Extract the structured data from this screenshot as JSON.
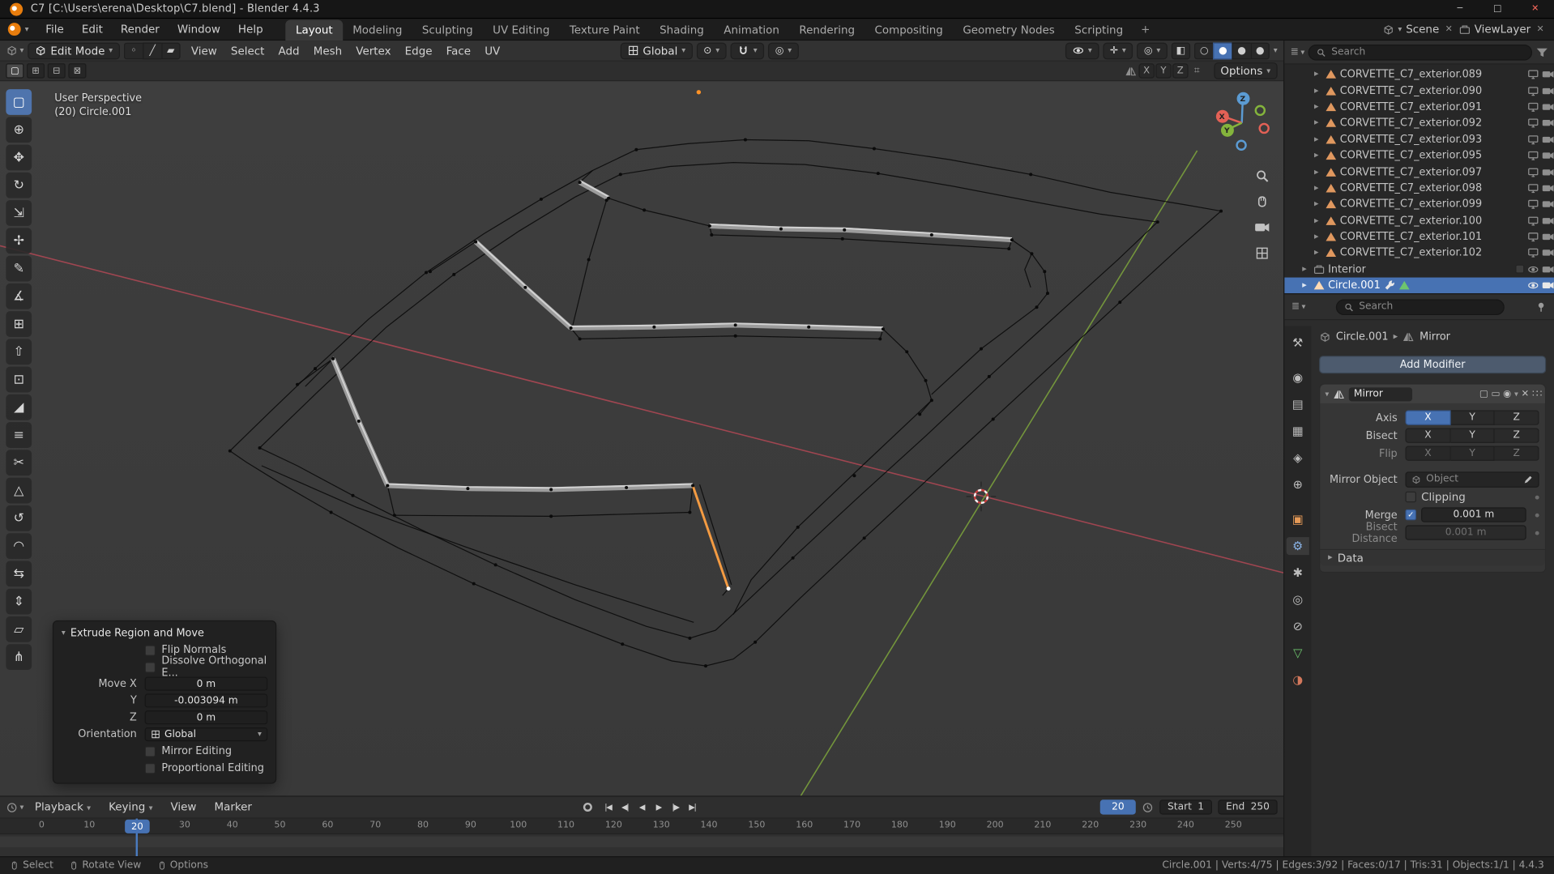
{
  "window": {
    "title": "C7 [C:\\Users\\erena\\Desktop\\C7.blend] - Blender 4.4.3",
    "minimize": "─",
    "maximize": "□",
    "close": "✕"
  },
  "topbar": {
    "menus": [
      "File",
      "Edit",
      "Render",
      "Window",
      "Help"
    ],
    "workspaces": [
      "Layout",
      "Modeling",
      "Sculpting",
      "UV Editing",
      "Texture Paint",
      "Shading",
      "Animation",
      "Rendering",
      "Compositing",
      "Geometry Nodes",
      "Scripting"
    ],
    "add_workspace": "+",
    "scene_label": "Scene",
    "view_layer_label": "ViewLayer"
  },
  "viewport": {
    "mode": "Edit Mode",
    "menus": [
      "View",
      "Select",
      "Add",
      "Mesh",
      "Vertex",
      "Edge",
      "Face",
      "UV"
    ],
    "orientation": "Global",
    "options_label": "Options",
    "overlay_line1": "User Perspective",
    "overlay_line2": "(20) Circle.001",
    "axes": [
      "X",
      "Y",
      "Z"
    ],
    "select_modes": [
      "◦",
      "╱",
      "▰"
    ],
    "tools": [
      {
        "name": "select-box-tool",
        "glyph": "▢"
      },
      {
        "name": "cursor-tool",
        "glyph": "⊕"
      },
      {
        "name": "move-tool",
        "glyph": "✥"
      },
      {
        "name": "rotate-tool",
        "glyph": "↻"
      },
      {
        "name": "scale-tool",
        "glyph": "⇲"
      },
      {
        "name": "transform-tool",
        "glyph": "✢"
      },
      {
        "name": "annotate-tool",
        "glyph": "✎"
      },
      {
        "name": "measure-tool",
        "glyph": "∡"
      },
      {
        "name": "add-cube-tool",
        "glyph": "⊞"
      },
      {
        "name": "extrude-region-tool",
        "glyph": "⇧"
      },
      {
        "name": "inset-faces-tool",
        "glyph": "⊡"
      },
      {
        "name": "bevel-tool",
        "glyph": "◢"
      },
      {
        "name": "loop-cut-tool",
        "glyph": "≡"
      },
      {
        "name": "knife-tool",
        "glyph": "✂"
      },
      {
        "name": "poly-build-tool",
        "glyph": "△"
      },
      {
        "name": "spin-tool",
        "glyph": "↺"
      },
      {
        "name": "smooth-tool",
        "glyph": "◠"
      },
      {
        "name": "edge-slide-tool",
        "glyph": "⇆"
      },
      {
        "name": "shrink-fatten-tool",
        "glyph": "⇕"
      },
      {
        "name": "shear-tool",
        "glyph": "▱"
      },
      {
        "name": "rip-region-tool",
        "glyph": "⋔"
      }
    ]
  },
  "operator_panel": {
    "title": "Extrude Region and Move",
    "flip_normals": "Flip Normals",
    "dissolve": "Dissolve Orthogonal E...",
    "move_x_label": "Move X",
    "move_x": "0 m",
    "y_label": "Y",
    "move_y": "-0.003094 m",
    "z_label": "Z",
    "move_z": "0 m",
    "orientation_label": "Orientation",
    "orientation_value": "Global",
    "mirror_editing": "Mirror Editing",
    "proportional_editing": "Proportional Editing"
  },
  "timeline": {
    "playback_label": "Playback",
    "keying_label": "Keying",
    "view_label": "View",
    "marker_label": "Marker",
    "transport": [
      {
        "name": "jump-to-start-button",
        "glyph": "|◀"
      },
      {
        "name": "jump-to-previous-keyframe-button",
        "glyph": "◀|"
      },
      {
        "name": "play-reverse-button",
        "glyph": "◀"
      },
      {
        "name": "play-button",
        "glyph": "▶"
      },
      {
        "name": "jump-to-next-keyframe-button",
        "glyph": "|▶"
      },
      {
        "name": "jump-to-end-button",
        "glyph": "▶|"
      }
    ],
    "current_frame": "20",
    "playhead_frame": "20",
    "start_label": "Start",
    "start_value": "1",
    "end_label": "End",
    "end_value": "250",
    "ticks": [
      "0",
      "10",
      "20",
      "30",
      "40",
      "50",
      "60",
      "70",
      "80",
      "90",
      "100",
      "110",
      "120",
      "130",
      "140",
      "150",
      "160",
      "170",
      "180",
      "190",
      "200",
      "210",
      "220",
      "230",
      "240",
      "250"
    ]
  },
  "outliner": {
    "search_placeholder": "Search",
    "collection_items": [
      "CORVETTE_C7_exterior.089",
      "CORVETTE_C7_exterior.090",
      "CORVETTE_C7_exterior.091",
      "CORVETTE_C7_exterior.092",
      "CORVETTE_C7_exterior.093",
      "CORVETTE_C7_exterior.095",
      "CORVETTE_C7_exterior.097",
      "CORVETTE_C7_exterior.098",
      "CORVETTE_C7_exterior.099",
      "CORVETTE_C7_exterior.100",
      "CORVETTE_C7_exterior.101",
      "CORVETTE_C7_exterior.102"
    ],
    "interior_label": "Interior",
    "selected_item": "Circle.001"
  },
  "properties": {
    "search_placeholder": "Search",
    "tabs": [
      {
        "name": "tab-tool",
        "glyph": "⚒"
      },
      {
        "name": "tab-render",
        "glyph": "◉"
      },
      {
        "name": "tab-output",
        "glyph": "▤"
      },
      {
        "name": "tab-view-layer",
        "glyph": "▦"
      },
      {
        "name": "tab-scene",
        "glyph": "◈"
      },
      {
        "name": "tab-world",
        "glyph": "⊕"
      },
      {
        "name": "tab-object",
        "glyph": "▣"
      },
      {
        "name": "tab-modifiers",
        "glyph": "⚙"
      },
      {
        "name": "tab-particles",
        "glyph": "✱"
      },
      {
        "name": "tab-physics",
        "glyph": "◎"
      },
      {
        "name": "tab-constraints",
        "glyph": "⊘"
      },
      {
        "name": "tab-object-data",
        "glyph": "▽"
      },
      {
        "name": "tab-material",
        "glyph": "◑"
      }
    ],
    "breadcrumb": {
      "object": "Circle.001",
      "separator": "▸",
      "modifier": "Mirror"
    },
    "add_modifier_label": "Add Modifier",
    "modifier": {
      "name": "Mirror",
      "axis_label": "Axis",
      "bisect_label": "Bisect",
      "flip_label": "Flip",
      "axes": [
        "X",
        "Y",
        "Z"
      ],
      "mirror_object_label": "Mirror Object",
      "object_placeholder": "Object",
      "clipping_label": "Clipping",
      "merge_label": "Merge",
      "merge_value": "0.001 m",
      "bisect_distance_label": "Bisect Distance",
      "bisect_distance_value": "0.001 m",
      "data_label": "Data"
    }
  },
  "statusbar": {
    "hints": [
      "Select",
      "Rotate View",
      "Options"
    ],
    "stats": "Circle.001 | Verts:4/75 | Edges:3/92 | Faces:0/17 | Tris:31 | Objects:1/1 | 4.4.3"
  }
}
